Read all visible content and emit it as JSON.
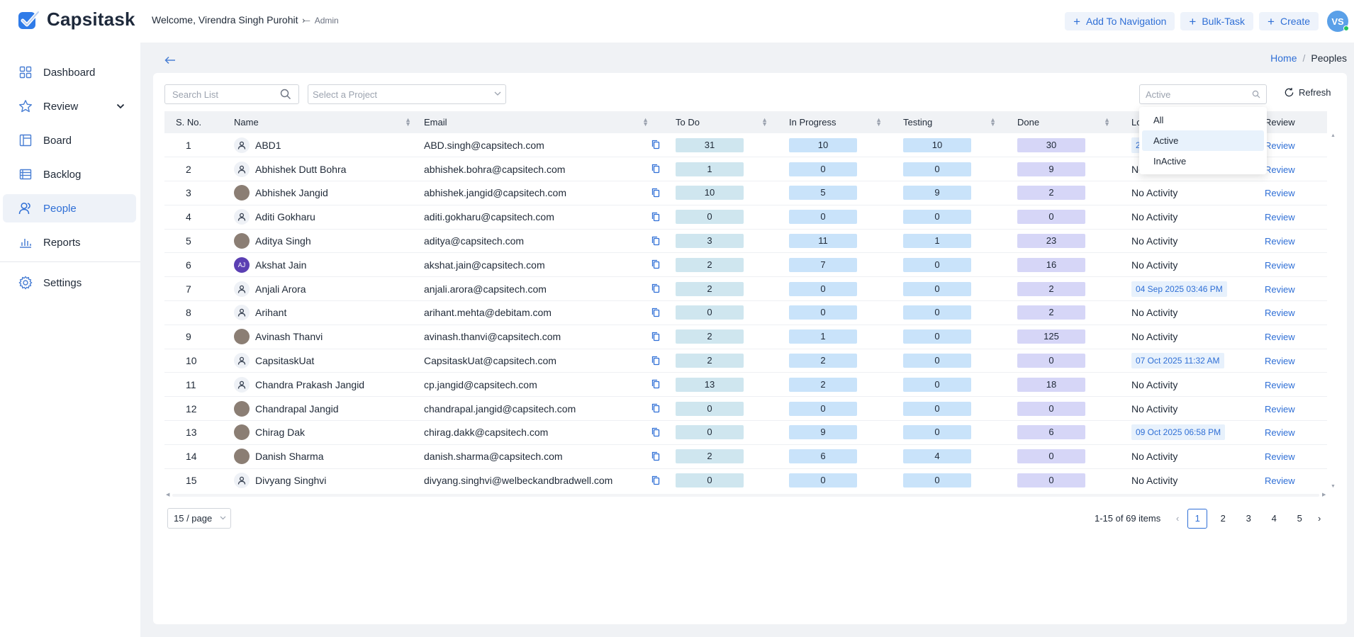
{
  "app": {
    "name": "Capsitask"
  },
  "header": {
    "welcome": "Welcome, Virendra Singh Purohit",
    "welcome_arrow": "⤚",
    "role": "Admin",
    "actions": [
      {
        "label": "Add To Navigation"
      },
      {
        "label": "Bulk-Task"
      },
      {
        "label": "Create"
      }
    ],
    "avatar_initials": "VS"
  },
  "sidebar": {
    "items": [
      {
        "label": "Dashboard",
        "icon": "grid-icon"
      },
      {
        "label": "Review",
        "icon": "star-icon"
      },
      {
        "label": "Board",
        "icon": "board-icon"
      },
      {
        "label": "Backlog",
        "icon": "list-icon"
      },
      {
        "label": "People",
        "icon": "users-icon",
        "active": true
      },
      {
        "label": "Reports",
        "icon": "bar-chart-icon"
      },
      {
        "label": "Settings",
        "icon": "gear-icon"
      }
    ]
  },
  "breadcrumb": {
    "home": "Home",
    "separator": "/",
    "current": "Peoples"
  },
  "filters": {
    "search_placeholder": "Search List",
    "project_placeholder": "Select a Project",
    "status_value": "Active",
    "refresh_label": "Refresh",
    "status_options": [
      "All",
      "Active",
      "InActive"
    ]
  },
  "table": {
    "columns": [
      "S. No.",
      "Name",
      "Email",
      "To Do",
      "In Progress",
      "Testing",
      "Done",
      "Lo",
      "Review"
    ],
    "review_label": "Review",
    "rows": [
      {
        "sno": "1",
        "name": "ABD1",
        "email": "ABD.singh@capsitech.com",
        "todo": "31",
        "progress": "10",
        "testing": "10",
        "done": "30",
        "last": "2",
        "last_is_date": true,
        "avatar": "default"
      },
      {
        "sno": "2",
        "name": "Abhishek Dutt Bohra",
        "email": "abhishek.bohra@capsitech.com",
        "todo": "1",
        "progress": "0",
        "testing": "0",
        "done": "9",
        "last": "No",
        "last_is_date": false,
        "avatar": "default"
      },
      {
        "sno": "3",
        "name": "Abhishek Jangid",
        "email": "abhishek.jangid@capsitech.com",
        "todo": "10",
        "progress": "5",
        "testing": "9",
        "done": "2",
        "last": "No Activity",
        "last_is_date": false,
        "avatar": "photo"
      },
      {
        "sno": "4",
        "name": "Aditi Gokharu",
        "email": "aditi.gokharu@capsitech.com",
        "todo": "0",
        "progress": "0",
        "testing": "0",
        "done": "0",
        "last": "No Activity",
        "last_is_date": false,
        "avatar": "default"
      },
      {
        "sno": "5",
        "name": "Aditya Singh",
        "email": "aditya@capsitech.com",
        "todo": "3",
        "progress": "11",
        "testing": "1",
        "done": "23",
        "last": "No Activity",
        "last_is_date": false,
        "avatar": "photo"
      },
      {
        "sno": "6",
        "name": "Akshat Jain",
        "email": "akshat.jain@capsitech.com",
        "todo": "2",
        "progress": "7",
        "testing": "0",
        "done": "16",
        "last": "No Activity",
        "last_is_date": false,
        "avatar": "aj"
      },
      {
        "sno": "7",
        "name": "Anjali Arora",
        "email": "anjali.arora@capsitech.com",
        "todo": "2",
        "progress": "0",
        "testing": "0",
        "done": "2",
        "last": "04 Sep 2025 03:46 PM",
        "last_is_date": true,
        "avatar": "default"
      },
      {
        "sno": "8",
        "name": "Arihant",
        "email": "arihant.mehta@debitam.com",
        "todo": "0",
        "progress": "0",
        "testing": "0",
        "done": "2",
        "last": "No Activity",
        "last_is_date": false,
        "avatar": "default"
      },
      {
        "sno": "9",
        "name": "Avinash Thanvi",
        "email": "avinash.thanvi@capsitech.com",
        "todo": "2",
        "progress": "1",
        "testing": "0",
        "done": "125",
        "last": "No Activity",
        "last_is_date": false,
        "avatar": "photo"
      },
      {
        "sno": "10",
        "name": "CapsitaskUat",
        "email": "CapsitaskUat@capsitech.com",
        "todo": "2",
        "progress": "2",
        "testing": "0",
        "done": "0",
        "last": "07 Oct 2025 11:32 AM",
        "last_is_date": true,
        "avatar": "default"
      },
      {
        "sno": "11",
        "name": "Chandra Prakash Jangid",
        "email": "cp.jangid@capsitech.com",
        "todo": "13",
        "progress": "2",
        "testing": "0",
        "done": "18",
        "last": "No Activity",
        "last_is_date": false,
        "avatar": "default"
      },
      {
        "sno": "12",
        "name": "Chandrapal Jangid",
        "email": "chandrapal.jangid@capsitech.com",
        "todo": "0",
        "progress": "0",
        "testing": "0",
        "done": "0",
        "last": "No Activity",
        "last_is_date": false,
        "avatar": "photo"
      },
      {
        "sno": "13",
        "name": "Chirag Dak",
        "email": "chirag.dakk@capsitech.com",
        "todo": "0",
        "progress": "9",
        "testing": "0",
        "done": "6",
        "last": "09 Oct 2025 06:58 PM",
        "last_is_date": true,
        "avatar": "photo"
      },
      {
        "sno": "14",
        "name": "Danish Sharma",
        "email": "danish.sharma@capsitech.com",
        "todo": "2",
        "progress": "6",
        "testing": "4",
        "done": "0",
        "last": "No Activity",
        "last_is_date": false,
        "avatar": "photo"
      },
      {
        "sno": "15",
        "name": "Divyang Singhvi",
        "email": "divyang.singhvi@welbeckandbradwell.com",
        "todo": "0",
        "progress": "0",
        "testing": "0",
        "done": "0",
        "last": "No Activity",
        "last_is_date": false,
        "avatar": "default"
      }
    ]
  },
  "pagination": {
    "page_size": "15 / page",
    "total": "1-15 of 69 items",
    "pages": [
      "1",
      "2",
      "3",
      "4",
      "5"
    ],
    "current": "1"
  },
  "colors": {
    "accent": "#2f6fd6",
    "todo": "#cfe6ef",
    "progress": "#c9e3fa",
    "done": "#d6d6f7"
  }
}
